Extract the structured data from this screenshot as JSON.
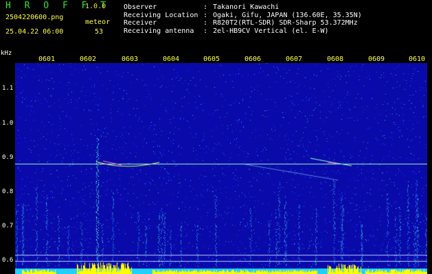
{
  "header": {
    "app_name": "H R O F F T",
    "app_version": "1.0.0",
    "filename": "2504220600.png",
    "datetime": "25.04.22 06:00",
    "mode_label": "meteor",
    "meteor_count": "53"
  },
  "info": {
    "rows": [
      {
        "label": "Observer",
        "sep": ":",
        "value": "Takanori Kawachi"
      },
      {
        "label": "Receiving Location",
        "sep": ":",
        "value": "Ogaki, Gifu, JAPAN (136.60E, 35.35N)"
      },
      {
        "label": "Receiver",
        "sep": ":",
        "value": "R820T2(RTL-SDR) SDR-Sharp 53.372MHz"
      },
      {
        "label": "Receiving antenna",
        "sep": ":",
        "value": "2el-HB9CV Vertical (el. E-W)"
      }
    ]
  },
  "axis": {
    "y_unit": "kHz",
    "y_ticks": [
      "1.1",
      "1.0",
      "0.9",
      "0.8",
      "0.7",
      "0.6"
    ],
    "x_ticks": [
      "0601",
      "0602",
      "0603",
      "0604",
      "0605",
      "0606",
      "0607",
      "0608",
      "0609",
      "0610"
    ]
  },
  "colors": {
    "background": "#000000",
    "spectrogram_base": "#0a0aa8",
    "tick_labels": "#ffff40",
    "app_name": "#2ee82e",
    "carrier_line": "#9affc0",
    "noise_floor": "#ffff00"
  }
}
